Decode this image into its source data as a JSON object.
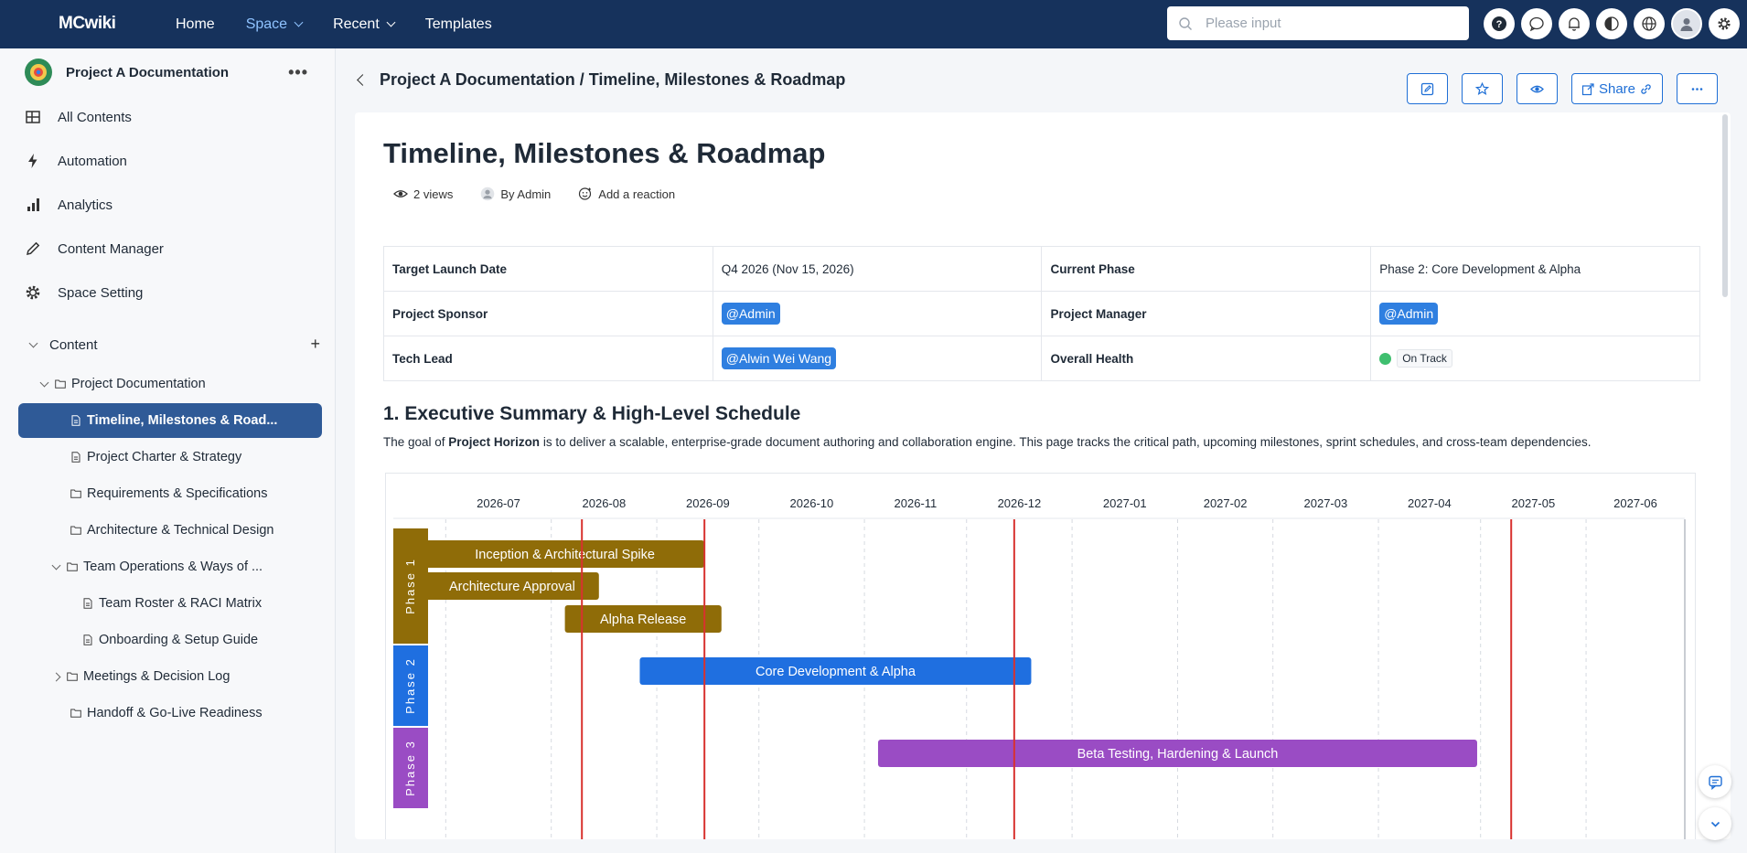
{
  "app": {
    "logo": "MCwiki",
    "nav": [
      {
        "label": "Home"
      },
      {
        "label": "Space"
      },
      {
        "label": "Recent"
      },
      {
        "label": "Templates"
      }
    ],
    "search_placeholder": "Please input",
    "brand_color": "#16325c",
    "accent_color": "#1f6fd6"
  },
  "sidebar": {
    "space_name": "Project A Documentation",
    "more": "•••",
    "menu": [
      {
        "label": "All Contents",
        "icon": "table-icon"
      },
      {
        "label": "Automation",
        "icon": "lightning-icon"
      },
      {
        "label": "Analytics",
        "icon": "bar-chart-icon"
      },
      {
        "label": "Content Manager",
        "icon": "pencil-icon"
      },
      {
        "label": "Space Setting",
        "icon": "gear-icon"
      }
    ],
    "content_label": "Content",
    "content_add": "+",
    "tree": [
      {
        "label": "Project Documentation",
        "type": "folder",
        "level": 1,
        "expand": "open"
      },
      {
        "label": "Timeline, Milestones & Road...",
        "type": "doc",
        "level": 2,
        "active": true
      },
      {
        "label": "Project Charter & Strategy",
        "type": "doc",
        "level": 2
      },
      {
        "label": "Requirements & Specifications",
        "type": "folder",
        "level": 2
      },
      {
        "label": "Architecture & Technical Design",
        "type": "folder",
        "level": 2
      },
      {
        "label": "Team Operations & Ways of ...",
        "type": "folder",
        "level": 2,
        "expand": "open"
      },
      {
        "label": "Team Roster & RACI Matrix",
        "type": "doc",
        "level": 3
      },
      {
        "label": "Onboarding & Setup Guide",
        "type": "doc",
        "level": 3
      },
      {
        "label": "Meetings & Decision Log",
        "type": "folder",
        "level": 2,
        "expand": "closed"
      },
      {
        "label": "Handoff & Go-Live Readiness",
        "type": "folder",
        "level": 2
      }
    ]
  },
  "main": {
    "breadcrumb": "Project A Documentation / Timeline, Milestones & Roadmap",
    "share_label": "Share",
    "title": "Timeline, Milestones & Roadmap",
    "meta": {
      "views": "2 views",
      "author": "By Admin",
      "reaction": "Add a reaction"
    },
    "properties": [
      [
        {
          "label": "Target Launch Date",
          "value": "Q4 2026 (Nov 15, 2026)",
          "kind": "text"
        },
        {
          "label": "Current Phase",
          "value": "Phase 2: Core Development & Alpha",
          "kind": "text"
        }
      ],
      [
        {
          "label": "Project Sponsor",
          "value": "@Admin",
          "kind": "mention"
        },
        {
          "label": "Project Manager",
          "value": "@Admin",
          "kind": "mention"
        }
      ],
      [
        {
          "label": "Tech Lead",
          "value": "@Alwin Wei Wang",
          "kind": "mention"
        },
        {
          "label": "Overall Health",
          "value": "On Track",
          "kind": "health"
        }
      ]
    ],
    "section_heading": "1. Executive Summary & High-Level Schedule",
    "summary_before": "The goal of ",
    "summary_bold": "Project Horizon",
    "summary_after": " is to deliver a scalable, enterprise-grade document authoring and collaboration engine. This page tracks the critical path, upcoming milestones, sprint schedules, and cross-team dependencies."
  },
  "chart_data": {
    "type": "gantt",
    "months": [
      "2026-07",
      "2026-08",
      "2026-09",
      "2026-10",
      "2026-11",
      "2026-12",
      "2027-01",
      "2027-02",
      "2027-03",
      "2027-04",
      "2027-05",
      "2027-06"
    ],
    "x_range": [
      "2026-06-25",
      "2027-06-30"
    ],
    "phases": [
      {
        "name": "Phase 1",
        "color": "#8f6c08",
        "rows": 3
      },
      {
        "name": "Phase 2",
        "color": "#1f6fe0",
        "rows": 1
      },
      {
        "name": "Phase 3",
        "color": "#9a4cc4",
        "rows": 1
      }
    ],
    "tasks": [
      {
        "name": "Inception & Architectural Spike",
        "phase": 0,
        "row": 0,
        "start": "2026-06-25",
        "end": "2026-09-15"
      },
      {
        "name": "Architecture Approval",
        "phase": 0,
        "row": 1,
        "start": "2026-06-25",
        "end": "2026-08-15"
      },
      {
        "name": "Alpha Release",
        "phase": 0,
        "row": 2,
        "start": "2026-08-05",
        "end": "2026-09-20"
      },
      {
        "name": "Core Development & Alpha",
        "phase": 1,
        "row": 0,
        "start": "2026-08-27",
        "end": "2026-12-20"
      },
      {
        "name": "Beta Testing, Hardening & Launch",
        "phase": 2,
        "row": 0,
        "start": "2026-11-05",
        "end": "2027-04-30"
      }
    ],
    "milestones": [
      "2026-08-10",
      "2026-09-15",
      "2026-12-15",
      "2027-05-10"
    ],
    "milestone_color": "#d8322f"
  }
}
